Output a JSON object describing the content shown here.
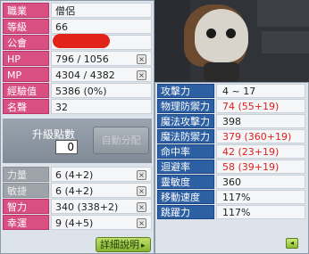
{
  "basic": {
    "job_label": "職業",
    "job_value": "僧侶",
    "level_label": "等級",
    "level_value": "66",
    "guild_label": "公會",
    "hp_label": "HP",
    "hp_value": "796 / 1056",
    "mp_label": "MP",
    "mp_value": "4304 / 4382",
    "exp_label": "經驗值",
    "exp_value": "5386 (0%)",
    "fame_label": "名聲",
    "fame_value": "32"
  },
  "ap": {
    "title": "升級點數",
    "value": "0",
    "auto_label": "自動分配"
  },
  "attributes": {
    "str_label": "力量",
    "str_value": "6 (4+2)",
    "dex_label": "敏捷",
    "dex_value": "6 (4+2)",
    "int_label": "智力",
    "int_value": "340 (338+2)",
    "luk_label": "幸運",
    "luk_value": "9 (4+5)"
  },
  "detail_button": "詳細說明",
  "details": {
    "atk_label": "攻擊力",
    "atk_value": "4 ~ 17",
    "pdef_label": "物理防禦力",
    "pdef_value": "74 (55+19)",
    "matk_label": "魔法攻擊力",
    "matk_value": "398",
    "mdef_label": "魔法防禦力",
    "mdef_value": "379 (360+19)",
    "acc_label": "命中率",
    "acc_value": "42 (23+19)",
    "eva_label": "迴避率",
    "eva_value": "58 (39+19)",
    "hands_label": "靈敏度",
    "hands_value": "360",
    "speed_label": "移動速度",
    "speed_value": "117%",
    "jump_label": "跳躍力",
    "jump_value": "117%"
  },
  "icons": {
    "plus": "×",
    "arrow": "▸",
    "back": "◂"
  },
  "colors": {
    "basic_label": "#d94f82",
    "attr_label_active": "#d94f82",
    "attr_label_disabled": "#9ea3a9",
    "detail_label": "#2d5fa3",
    "bonus_text": "#e0201d"
  }
}
